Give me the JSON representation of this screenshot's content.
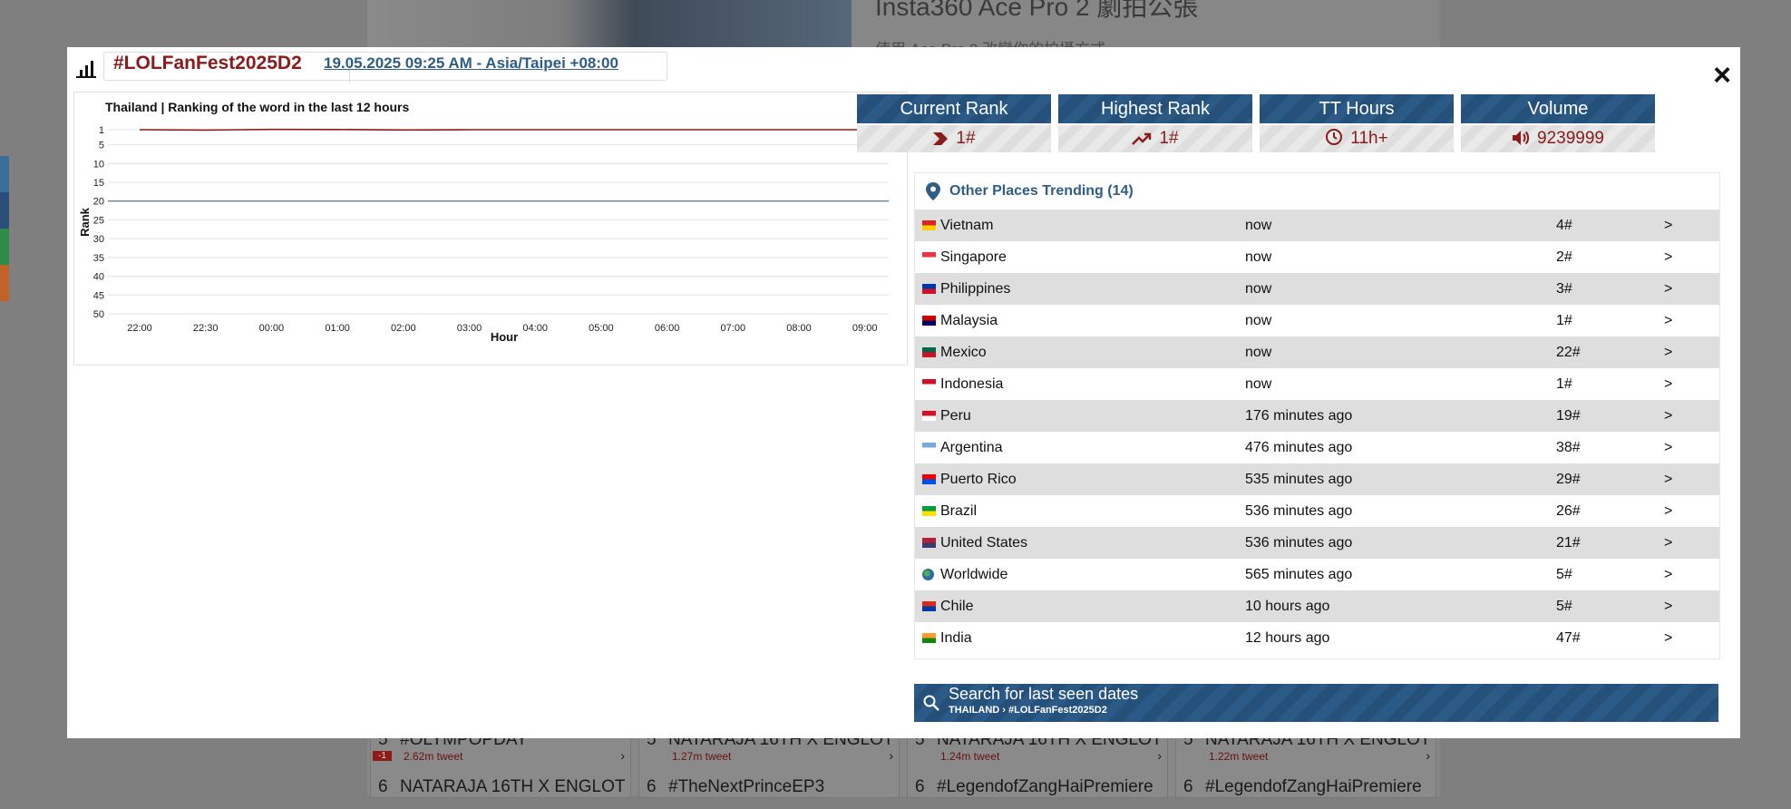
{
  "background": {
    "hero_title": "Insta360 Ace Pro 2 劇拍公張",
    "hero_subtitle": "使用 Ace Pro 2 改變你的拍攝方式 ›",
    "cards": [
      {
        "rows": [
          {
            "num": "5",
            "text": "#OLYMPOPDAY",
            "sub": "2.62m tweet",
            "delta": "-1"
          },
          {
            "num": "6",
            "text": "NATARAJA 16TH X ENGLOT",
            "sub": "",
            "delta": ""
          }
        ]
      },
      {
        "rows": [
          {
            "num": "5",
            "text": "NATARAJA 16TH X ENGLOT",
            "sub": "1.27m tweet",
            "delta": ""
          },
          {
            "num": "6",
            "text": "#TheNextPrinceEP3",
            "sub": "",
            "delta": ""
          }
        ]
      },
      {
        "rows": [
          {
            "num": "5",
            "text": "NATARAJA 16TH X ENGLOT",
            "sub": "1.24m tweet",
            "delta": ""
          },
          {
            "num": "6",
            "text": "#LegendofZangHaiPremiere",
            "sub": "",
            "delta": ""
          }
        ]
      },
      {
        "rows": [
          {
            "num": "5",
            "text": "NATARAJA 16TH X ENGLOT",
            "sub": "1.22m tweet",
            "delta": ""
          },
          {
            "num": "6",
            "text": "#LegendofZangHaiPremiere",
            "sub": "",
            "delta": ""
          }
        ]
      }
    ],
    "side_colors": [
      "#3b6f9a",
      "#2b4e78",
      "#2e8b4a",
      "#c0622a"
    ]
  },
  "modal": {
    "hashtag": "#LOLFanFest2025D2",
    "datetime": "19.05.2025 09:25 AM - Asia/Taipei +08:00",
    "close_label": "×",
    "stats": [
      {
        "label": "Current Rank",
        "value": "1#",
        "icon": "chevron-right-icon"
      },
      {
        "label": "Highest Rank",
        "value": "1#",
        "icon": "trending-up-icon"
      },
      {
        "label": "TT Hours",
        "value": "11h+",
        "icon": "clock-icon"
      },
      {
        "label": "Volume",
        "value": "9239999",
        "icon": "speaker-icon"
      }
    ],
    "places_title": "Other Places Trending (14)",
    "places": [
      {
        "country": "Vietnam",
        "when": "now",
        "rank": "4#",
        "flag": [
          "#da251d",
          "#ffcd00"
        ]
      },
      {
        "country": "Singapore",
        "when": "now",
        "rank": "2#",
        "flag": [
          "#ef3340",
          "#ffffff"
        ]
      },
      {
        "country": "Philippines",
        "when": "now",
        "rank": "3#",
        "flag": [
          "#0038a8",
          "#ce1126"
        ]
      },
      {
        "country": "Malaysia",
        "when": "now",
        "rank": "1#",
        "flag": [
          "#cc0001",
          "#010066"
        ]
      },
      {
        "country": "Mexico",
        "when": "now",
        "rank": "22#",
        "flag": [
          "#006847",
          "#ce1126"
        ]
      },
      {
        "country": "Indonesia",
        "when": "now",
        "rank": "1#",
        "flag": [
          "#ce1126",
          "#ffffff"
        ]
      },
      {
        "country": "Peru",
        "when": "176 minutes ago",
        "rank": "19#",
        "flag": [
          "#d91023",
          "#ffffff"
        ]
      },
      {
        "country": "Argentina",
        "when": "476 minutes ago",
        "rank": "38#",
        "flag": [
          "#74acdf",
          "#ffffff"
        ]
      },
      {
        "country": "Puerto Rico",
        "when": "535 minutes ago",
        "rank": "29#",
        "flag": [
          "#ed0000",
          "#0050f0"
        ]
      },
      {
        "country": "Brazil",
        "when": "536 minutes ago",
        "rank": "26#",
        "flag": [
          "#009c3b",
          "#ffdf00"
        ]
      },
      {
        "country": "United States",
        "when": "536 minutes ago",
        "rank": "21#",
        "flag": [
          "#b22234",
          "#3c3b6e"
        ]
      },
      {
        "country": "Worldwide",
        "when": "565 minutes ago",
        "rank": "5#",
        "flag": [
          "#2e6da4",
          "#4caf50"
        ]
      },
      {
        "country": "Chile",
        "when": "10 hours ago",
        "rank": "5#",
        "flag": [
          "#d52b1e",
          "#0039a6"
        ]
      },
      {
        "country": "India",
        "when": "12 hours ago",
        "rank": "47#",
        "flag": [
          "#ff9933",
          "#138808"
        ]
      }
    ],
    "row_arrow": ">",
    "search_title": "Search for last seen dates",
    "search_sub": "THAILAND › #LOLFanFest2025D2"
  },
  "chart_data": {
    "type": "line",
    "title": "Thailand | Ranking of the word in the last 12 hours",
    "xlabel": "Hour",
    "ylabel": "Rank",
    "categories": [
      "22:00",
      "22:30",
      "00:00",
      "01:00",
      "02:00",
      "03:00",
      "04:00",
      "05:00",
      "06:00",
      "07:00",
      "08:00",
      "09:00"
    ],
    "y_ticks": [
      1,
      5,
      10,
      15,
      20,
      25,
      30,
      35,
      40,
      45,
      50
    ],
    "ylim": [
      1,
      50
    ],
    "y_inverted": true,
    "grid": true,
    "series": [
      {
        "values": [
          1,
          1,
          1,
          1,
          1,
          1,
          1,
          1,
          1,
          1,
          1,
          1
        ],
        "color": "#8b1a1a"
      }
    ],
    "reference_line": {
      "value": 20,
      "color": "#2e5d85"
    }
  }
}
